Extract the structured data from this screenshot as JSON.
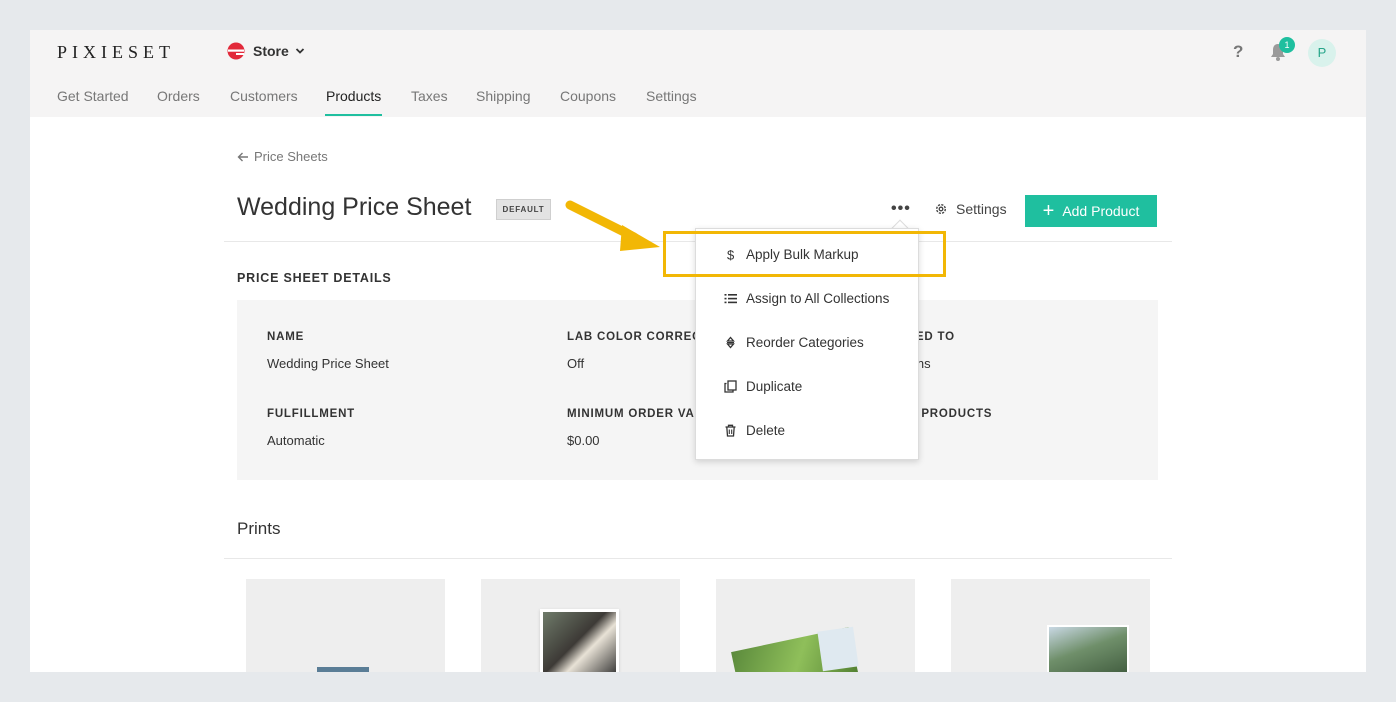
{
  "app": {
    "logo": "PIXIESET",
    "product_switcher": "Store",
    "help": "?",
    "notification_count": "1",
    "avatar_initial": "P"
  },
  "nav": {
    "tabs": [
      {
        "label": "Get Started"
      },
      {
        "label": "Orders"
      },
      {
        "label": "Customers"
      },
      {
        "label": "Products",
        "active": true
      },
      {
        "label": "Taxes"
      },
      {
        "label": "Shipping"
      },
      {
        "label": "Coupons"
      },
      {
        "label": "Settings"
      }
    ]
  },
  "page": {
    "back_label": "Price Sheets",
    "title": "Wedding Price Sheet",
    "badge": "DEFAULT",
    "more": "•••",
    "settings_label": "Settings",
    "add_label": "Add Product"
  },
  "details": {
    "heading": "PRICE SHEET DETAILS",
    "fields": [
      {
        "label": "NAME",
        "value": "Wedding Price Sheet"
      },
      {
        "label": "LAB COLOR CORRECTION",
        "value": "Off"
      },
      {
        "label": "ASSIGNED TO",
        "value": "Collections"
      },
      {
        "label": "FULFILLMENT",
        "value": "Automatic"
      },
      {
        "label": "MINIMUM ORDER VALUE",
        "value": "$0.00"
      },
      {
        "label": "VISIBLE PRODUCTS",
        "value": ""
      }
    ]
  },
  "section": {
    "prints_heading": "Prints"
  },
  "menu": {
    "items": [
      {
        "label": "Apply Bulk Markup",
        "icon": "dollar-icon"
      },
      {
        "label": "Assign to All Collections",
        "icon": "list-icon"
      },
      {
        "label": "Reorder Categories",
        "icon": "reorder-icon"
      },
      {
        "label": "Duplicate",
        "icon": "copy-icon"
      },
      {
        "label": "Delete",
        "icon": "trash-icon"
      }
    ]
  },
  "colors": {
    "accent": "#1fbf9f",
    "highlight": "#f2b705",
    "store_icon": "#e2293a"
  }
}
